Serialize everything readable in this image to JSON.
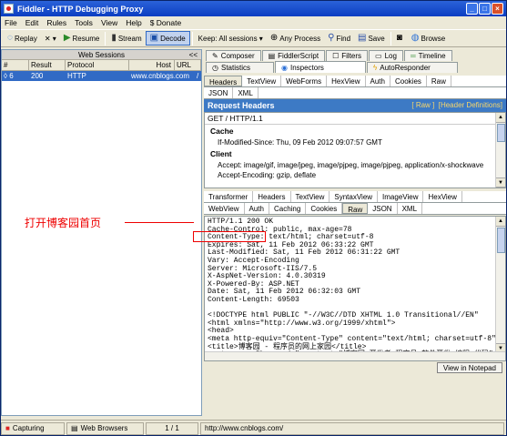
{
  "window": {
    "title": "Fiddler - HTTP Debugging Proxy",
    "min_label": "_",
    "max_label": "□",
    "close_label": "×"
  },
  "menu": [
    "File",
    "Edit",
    "Rules",
    "Tools",
    "View",
    "Help",
    "$ Donate"
  ],
  "toolbar": {
    "replay": "Replay",
    "remove": "✕ ▾",
    "resume": "Resume",
    "stream": "Stream",
    "decode": "Decode",
    "keep": "Keep: All sessions ▾",
    "any_process": "Any Process",
    "find": "Find",
    "save": "Save",
    "browse": "Browse"
  },
  "sessions": {
    "title": "Web Sessions",
    "collapse": "<<",
    "columns": [
      "#",
      "Result",
      "Protocol",
      "Host",
      "URL"
    ],
    "rows": [
      {
        "num": "6",
        "result": "200",
        "protocol": "HTTP",
        "host": "www.cnblogs.com",
        "url": "/"
      }
    ]
  },
  "tabs": {
    "row1": [
      "Composer",
      "FiddlerScript",
      "Filters",
      "Log",
      "Timeline"
    ],
    "row2": [
      "Statistics",
      "Inspectors",
      "AutoResponder"
    ]
  },
  "request": {
    "subtabs": [
      "Headers",
      "TextView",
      "WebForms",
      "HexView",
      "Auth",
      "Cookies",
      "Raw"
    ],
    "subtabs2": [
      "JSON",
      "XML"
    ],
    "header_title": "Request Headers",
    "raw_link": "[ Raw ]",
    "defs_link": "[Header Definitions]",
    "request_line": "GET / HTTP/1.1",
    "cache_label": "Cache",
    "cache_lines": [
      "If-Modified-Since: Thu, 09 Feb 2012 09:07:57 GMT"
    ],
    "client_label": "Client",
    "client_lines": [
      "Accept: image/gif, image/jpeg, image/pjpeg, image/pjpeg, application/x-shockwave",
      "Accept-Encoding: gzip, deflate"
    ]
  },
  "response": {
    "subtabs": [
      "Transformer",
      "Headers",
      "TextView",
      "SyntaxView",
      "ImageView",
      "HexView"
    ],
    "subtabs2": [
      "WebView",
      "Auth",
      "Caching",
      "Cookies",
      "Raw",
      "JSON",
      "XML"
    ],
    "raw_lines": [
      "HTTP/1.1 200 OK",
      "Cache-Control: public, max-age=78",
      "Content-Type: text/html; charset=utf-8",
      "Expires: Sat, 11 Feb 2012 06:33:22 GMT",
      "Last-Modified: Sat, 11 Feb 2012 06:31:22 GMT",
      "Vary: Accept-Encoding",
      "Server: Microsoft-IIS/7.5",
      "X-AspNet-Version: 4.0.30319",
      "X-Powered-By: ASP.NET",
      "Date: Sat, 11 Feb 2012 06:32:03 GMT",
      "Content-Length: 69503",
      "",
      "<!DOCTYPE html PUBLIC \"-//W3C//DTD XHTML 1.0 Transitional//EN\"",
      "<html xmlns=\"http://www.w3.org/1999/xhtml\">",
      "<head>",
      "<meta http-equiv=\"Content-Type\" content=\"text/html; charset=utf-8\"",
      "<title>博客园 - 程序员的网上家园</title>",
      "<meta name=\"keywords\" content=\"博客园,开发者,程序员,软件开发,编程,代码\""
    ],
    "notepad": "View in Notepad"
  },
  "status": {
    "capturing": "Capturing",
    "browsers": "Web Browsers",
    "count": "1 / 1",
    "url": "http://www.cnblogs.com/"
  },
  "annotation": "打开博客园首页"
}
